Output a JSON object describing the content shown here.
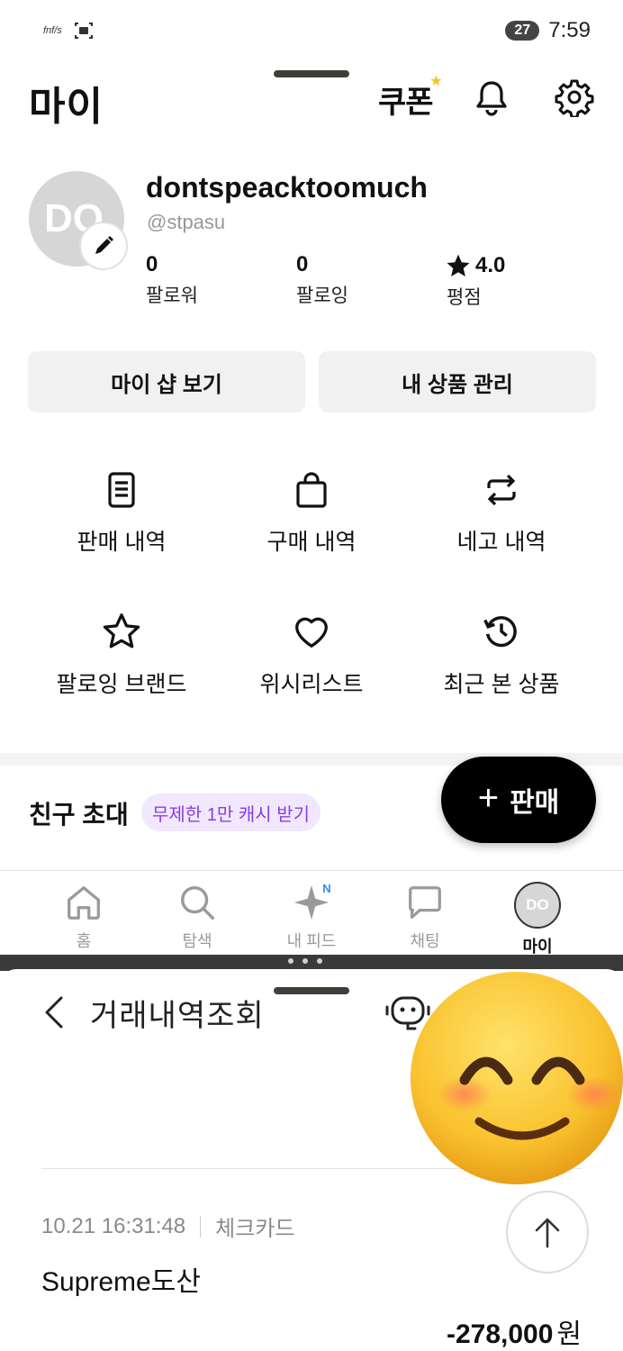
{
  "status": {
    "mini_label": "fnf/s",
    "battery": "27",
    "time": "7:59"
  },
  "header": {
    "title": "마이",
    "coupon_label": "쿠폰"
  },
  "profile": {
    "avatar_initials": "DO",
    "username": "dontspeacktoomuch",
    "handle": "@stpasu",
    "stats": [
      {
        "value": "0",
        "label": "팔로워"
      },
      {
        "value": "0",
        "label": "팔로잉"
      },
      {
        "value": "4.0",
        "label": "평점",
        "icon": "star-icon"
      }
    ]
  },
  "actions": {
    "my_shop": "마이 샵 보기",
    "my_products": "내 상품 관리"
  },
  "menu": [
    {
      "label": "판매 내역",
      "icon": "document-list-icon"
    },
    {
      "label": "구매 내역",
      "icon": "shopping-bag-icon"
    },
    {
      "label": "네고 내역",
      "icon": "exchange-arrows-icon"
    },
    {
      "label": "팔로잉 브랜드",
      "icon": "star-outline-icon"
    },
    {
      "label": "위시리스트",
      "icon": "heart-icon"
    },
    {
      "label": "최근 본 상품",
      "icon": "history-clock-icon"
    }
  ],
  "invite": {
    "title": "친구 초대",
    "chip": "무제한 1만 캐시 받기"
  },
  "fab": {
    "label": "판매"
  },
  "nav": [
    {
      "label": "홈",
      "icon": "home-icon"
    },
    {
      "label": "탐색",
      "icon": "search-icon"
    },
    {
      "label": "내 피드",
      "icon": "sparkle-icon",
      "badge": "N"
    },
    {
      "label": "채팅",
      "icon": "chat-bubble-icon"
    },
    {
      "label": "마이",
      "icon": "avatar",
      "avatar_initials": "DO",
      "active": true
    }
  ],
  "lower_app": {
    "title": "거래내역조회",
    "transaction": {
      "datetime": "10.21 16:31:48",
      "type": "체크카드",
      "merchant": "Supreme도산",
      "amount": "-278,000",
      "currency": "원"
    }
  },
  "colors": {
    "accent_purple": "#8b3fe0",
    "chip_bg": "#f1e8ff",
    "fab_bg": "#000000",
    "coupon_star": "#f5c518"
  }
}
